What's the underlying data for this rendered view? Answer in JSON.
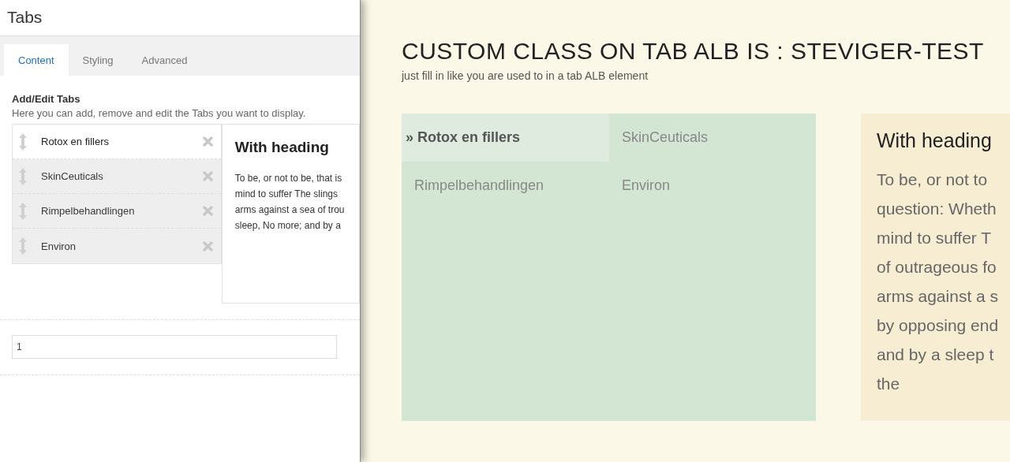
{
  "editor": {
    "title": "Tabs",
    "tabs": [
      {
        "label": "Content",
        "selected": true
      },
      {
        "label": "Styling",
        "selected": false
      },
      {
        "label": "Advanced",
        "selected": false
      }
    ],
    "section_title": "Add/Edit Tabs",
    "section_description": "Here you can add, remove and edit the Tabs you want to display.",
    "tab_items": [
      {
        "label": "Rotox en fillers",
        "selected": true
      },
      {
        "label": "SkinCeuticals",
        "selected": false
      },
      {
        "label": "Rimpelbehandlingen",
        "selected": false
      },
      {
        "label": "Environ",
        "selected": false
      }
    ],
    "preview": {
      "heading": "With heading",
      "lines": [
        "To be, or not to be, that is",
        "mind to suffer The slings",
        "arms against a sea of trou",
        "sleep, No more; and by a"
      ]
    },
    "number_field": {
      "value": "1"
    }
  },
  "page": {
    "title": "CUSTOM CLASS ON TAB ALB IS : STEVIGER-TEST",
    "subtitle": "just fill in like you are used to in a tab ALB element",
    "tabs": [
      {
        "label": "» Rotox en fillers",
        "selected": true
      },
      {
        "label": "SkinCeuticals",
        "selected": false
      },
      {
        "label": "Rimpelbehandlingen",
        "selected": false
      },
      {
        "label": "Environ",
        "selected": false
      }
    ],
    "content": {
      "heading": "With heading",
      "lines": [
        "To be, or not to",
        "question: Wheth",
        "mind to suffer T",
        "of outrageous fo",
        "arms against a s",
        "by opposing end",
        "and by a sleep t",
        "the"
      ]
    }
  }
}
